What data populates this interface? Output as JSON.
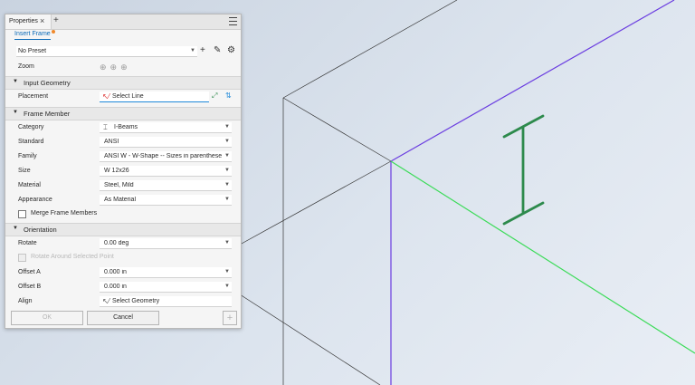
{
  "tabs": [
    {
      "label": "Properties",
      "close": "×"
    }
  ],
  "tab_add": "+",
  "command_tab": "Insert Frame",
  "preset": {
    "value": "No Preset",
    "tools": [
      "+",
      "✎",
      "⚙"
    ]
  },
  "zoom": {
    "label": "Zoom",
    "icons": [
      "zoom-fit-icon",
      "zoom-in-icon",
      "zoom-out-icon"
    ]
  },
  "sections": {
    "input_geometry": "Input Geometry",
    "frame_member": "Frame Member",
    "orientation": "Orientation"
  },
  "placement": {
    "label": "Placement",
    "value": "Select Line"
  },
  "frame_member": [
    {
      "label": "Category",
      "value": "I-Beams"
    },
    {
      "label": "Standard",
      "value": "ANSI"
    },
    {
      "label": "Family",
      "value": "ANSI W - W-Shape -- Sizes in parentheses h"
    },
    {
      "label": "Size",
      "value": "W 12x26"
    },
    {
      "label": "Material",
      "value": "Steel, Mild"
    },
    {
      "label": "Appearance",
      "value": "As Material"
    }
  ],
  "merge": {
    "label": "Merge Frame Members"
  },
  "orientation": {
    "rotate": {
      "label": "Rotate",
      "value": "0.00 deg"
    },
    "rotate_around": {
      "label": "Rotate Around Selected Point"
    },
    "offset_a": {
      "label": "Offset A",
      "value": "0.000 in"
    },
    "offset_b": {
      "label": "Offset B",
      "value": "0.000 in"
    },
    "align": {
      "label": "Align",
      "value": "Select Geometry"
    }
  },
  "buttons": {
    "ok": "OK",
    "cancel": "Cancel",
    "apply": "+"
  },
  "colors": {
    "accent": "#0a6ab8",
    "purple_edge": "#6a3ce0",
    "green_edge": "#3adb57",
    "beam": "#2d8a4c"
  }
}
